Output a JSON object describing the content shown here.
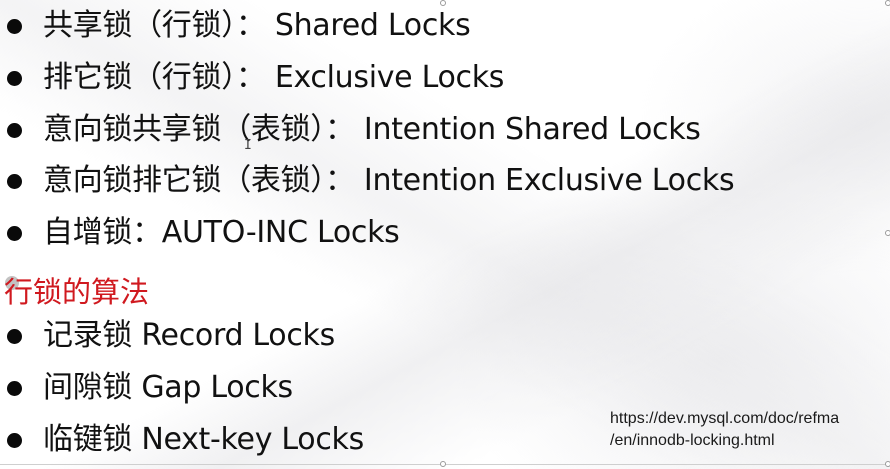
{
  "bullets_lock_types": [
    {
      "text": "共享锁（行锁）： Shared Locks"
    },
    {
      "text": "排它锁（行锁）： Exclusive Locks"
    },
    {
      "text": "意向锁共享锁（表锁）： Intention Shared  Locks"
    },
    {
      "text": "意向锁排它锁（表锁）： Intention Exclusive Locks"
    },
    {
      "text": "自增锁：AUTO-INC Locks"
    }
  ],
  "section_heading": "行锁的算法",
  "bullets_row_lock_algorithms": [
    {
      "text": "记录锁 Record Locks"
    },
    {
      "text": "间隙锁 Gap Locks"
    },
    {
      "text": "临键锁 Next-key Locks"
    }
  ],
  "reference_url": {
    "line1": "https://dev.mysql.com/doc/refma",
    "line2": "/en/innodb-locking.html"
  },
  "colors": {
    "heading": "#d0191f",
    "text": "#111111",
    "bullet": "#0a0a0a"
  }
}
